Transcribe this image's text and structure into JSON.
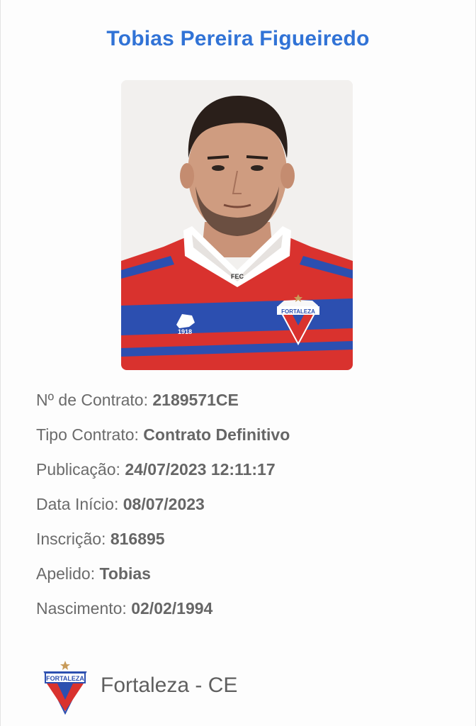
{
  "player": {
    "name": "Tobias Pereira Figueiredo"
  },
  "details": [
    {
      "label": "Nº de Contrato: ",
      "value": "2189571CE"
    },
    {
      "label": "Tipo Contrato: ",
      "value": "Contrato Definitivo"
    },
    {
      "label": "Publicação: ",
      "value": "24/07/2023 12:11:17"
    },
    {
      "label": "Data Início: ",
      "value": "08/07/2023"
    },
    {
      "label": "Inscrição: ",
      "value": "816895"
    },
    {
      "label": "Apelido: ",
      "value": "Tobias"
    },
    {
      "label": "Nascimento: ",
      "value": "02/02/1994"
    }
  ],
  "club": {
    "name": "Fortaleza - CE",
    "crest_text": "FORTALEZA"
  },
  "jersey": {
    "chest_text": "FEC",
    "lion_text": "1918"
  },
  "colors": {
    "name": "#3173d6",
    "red": "#d9322e",
    "blue": "#2c4fb0"
  }
}
